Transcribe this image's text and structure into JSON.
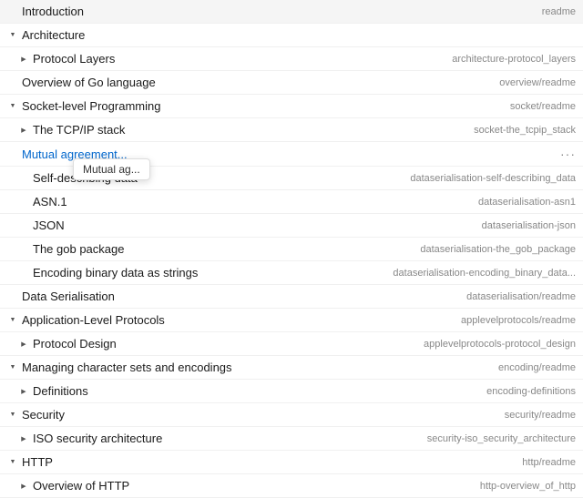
{
  "items": [
    {
      "id": "introduction",
      "indent": 0,
      "label": "Introduction",
      "route": "readme",
      "hasChevron": false,
      "chevronType": null,
      "expanded": false,
      "isActive": false,
      "isBlue": false
    },
    {
      "id": "architecture",
      "indent": 0,
      "label": "Architecture",
      "route": "",
      "hasChevron": true,
      "chevronType": "down",
      "expanded": true,
      "isActive": false,
      "isBlue": false
    },
    {
      "id": "protocol-layers",
      "indent": 1,
      "label": "Protocol Layers",
      "route": "architecture-protocol_layers",
      "hasChevron": true,
      "chevronType": "right",
      "expanded": false,
      "isActive": false,
      "isBlue": false
    },
    {
      "id": "overview-go",
      "indent": 0,
      "label": "Overview of Go language",
      "route": "overview/readme",
      "hasChevron": false,
      "chevronType": null,
      "expanded": false,
      "isActive": false,
      "isBlue": false
    },
    {
      "id": "socket-level",
      "indent": 0,
      "label": "Socket-level Programming",
      "route": "socket/readme",
      "hasChevron": true,
      "chevronType": "down",
      "expanded": true,
      "isActive": false,
      "isBlue": false
    },
    {
      "id": "tcpip",
      "indent": 1,
      "label": "The TCP/IP stack",
      "route": "socket-the_tcpip_stack",
      "hasChevron": true,
      "chevronType": "right",
      "expanded": false,
      "isActive": false,
      "isBlue": false
    },
    {
      "id": "mutual-agreement",
      "indent": 0,
      "label": "Mutual agreement...",
      "route": "...",
      "hasChevron": false,
      "chevronType": null,
      "expanded": false,
      "isActive": true,
      "isBlue": true,
      "hasTooltip": true,
      "tooltipText": "Mutual ag...",
      "isEllipsis": true
    },
    {
      "id": "self-describing",
      "indent": 1,
      "label": "Self-describing data",
      "route": "dataserialisation-self-describing_data",
      "hasChevron": false,
      "chevronType": null,
      "expanded": false,
      "isActive": false,
      "isBlue": false
    },
    {
      "id": "asn1",
      "indent": 1,
      "label": "ASN.1",
      "route": "dataserialisation-asn1",
      "hasChevron": false,
      "chevronType": null,
      "expanded": false,
      "isActive": false,
      "isBlue": false
    },
    {
      "id": "json",
      "indent": 1,
      "label": "JSON",
      "route": "dataserialisation-json",
      "hasChevron": false,
      "chevronType": null,
      "expanded": false,
      "isActive": false,
      "isBlue": false
    },
    {
      "id": "gob",
      "indent": 1,
      "label": "The gob package",
      "route": "dataserialisation-the_gob_package",
      "hasChevron": false,
      "chevronType": null,
      "expanded": false,
      "isActive": false,
      "isBlue": false
    },
    {
      "id": "encoding-binary",
      "indent": 1,
      "label": "Encoding binary data as strings",
      "route": "dataserialisation-encoding_binary_data...",
      "hasChevron": false,
      "chevronType": null,
      "expanded": false,
      "isActive": false,
      "isBlue": false
    },
    {
      "id": "data-serialisation",
      "indent": 0,
      "label": "Data Serialisation",
      "route": "dataserialisation/readme",
      "hasChevron": false,
      "chevronType": null,
      "expanded": false,
      "isActive": false,
      "isBlue": false
    },
    {
      "id": "app-level",
      "indent": 0,
      "label": "Application-Level Protocols",
      "route": "applevelprotocols/readme",
      "hasChevron": true,
      "chevronType": "down",
      "expanded": true,
      "isActive": false,
      "isBlue": false
    },
    {
      "id": "protocol-design",
      "indent": 1,
      "label": "Protocol Design",
      "route": "applevelprotocols-protocol_design",
      "hasChevron": true,
      "chevronType": "right",
      "expanded": false,
      "isActive": false,
      "isBlue": false
    },
    {
      "id": "managing-charsets",
      "indent": 0,
      "label": "Managing character sets and encodings",
      "route": "encoding/readme",
      "hasChevron": true,
      "chevronType": "down",
      "expanded": true,
      "isActive": false,
      "isBlue": false
    },
    {
      "id": "definitions",
      "indent": 1,
      "label": "Definitions",
      "route": "encoding-definitions",
      "hasChevron": true,
      "chevronType": "right",
      "expanded": false,
      "isActive": false,
      "isBlue": false
    },
    {
      "id": "security",
      "indent": 0,
      "label": "Security",
      "route": "security/readme",
      "hasChevron": true,
      "chevronType": "down",
      "expanded": true,
      "isActive": false,
      "isBlue": false
    },
    {
      "id": "iso-security",
      "indent": 1,
      "label": "ISO security architecture",
      "route": "security-iso_security_architecture",
      "hasChevron": true,
      "chevronType": "right",
      "expanded": false,
      "isActive": false,
      "isBlue": false
    },
    {
      "id": "http",
      "indent": 0,
      "label": "HTTP",
      "route": "http/readme",
      "hasChevron": true,
      "chevronType": "down",
      "expanded": true,
      "isActive": false,
      "isBlue": false
    },
    {
      "id": "overview-http",
      "indent": 1,
      "label": "Overview of HTTP",
      "route": "http-overview_of_http",
      "hasChevron": true,
      "chevronType": "right",
      "expanded": false,
      "isActive": false,
      "isBlue": false
    }
  ],
  "tooltip": {
    "text": "Mutual ag..."
  }
}
